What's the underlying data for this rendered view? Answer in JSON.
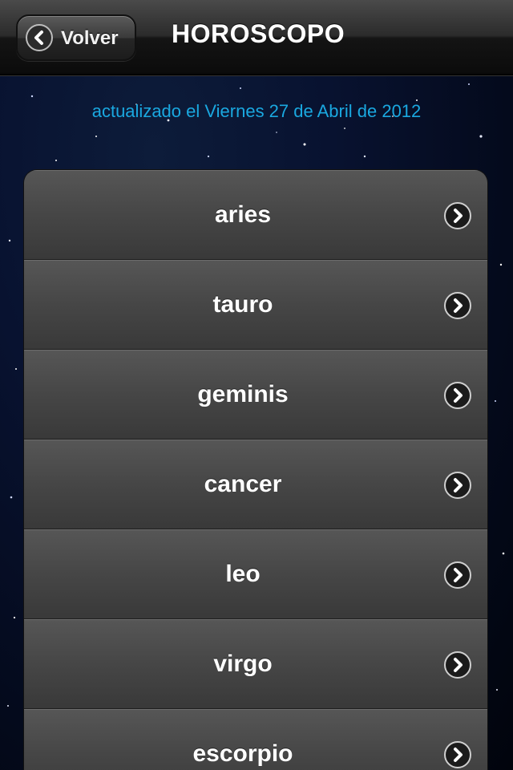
{
  "navbar": {
    "back_label": "Volver",
    "title": "HOROSCOPO"
  },
  "updated": "actualizado el Viernes 27 de Abril de 2012",
  "signs": [
    {
      "label": "aries"
    },
    {
      "label": "tauro"
    },
    {
      "label": "geminis"
    },
    {
      "label": "cancer"
    },
    {
      "label": "leo"
    },
    {
      "label": "virgo"
    },
    {
      "label": "escorpio"
    }
  ],
  "colors": {
    "updated_text": "#1aa8e0",
    "background": "#081230"
  },
  "icons": {
    "back": "chevron-left-icon",
    "row_disclosure": "chevron-right-icon"
  }
}
